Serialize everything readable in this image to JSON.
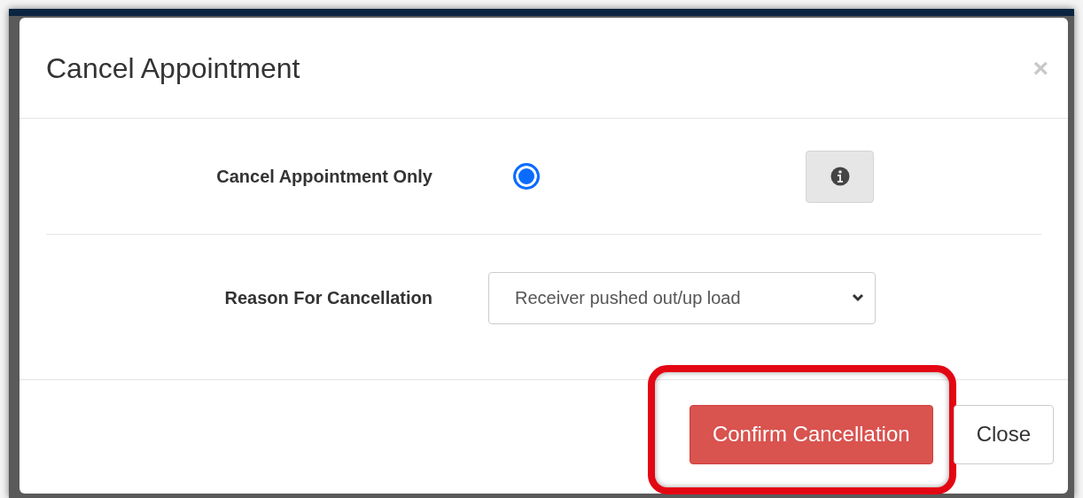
{
  "dialog": {
    "title": "Cancel Appointment",
    "close_glyph": "×"
  },
  "option": {
    "label": "Cancel Appointment Only",
    "selected": true
  },
  "reason": {
    "label": "Reason For Cancellation",
    "value": "Receiver pushed out/up load"
  },
  "buttons": [
    {
      "kind": "danger",
      "label": "Confirm Cancellation",
      "highlighted": true
    },
    {
      "kind": "default",
      "label": "Close",
      "highlighted": false
    }
  ]
}
